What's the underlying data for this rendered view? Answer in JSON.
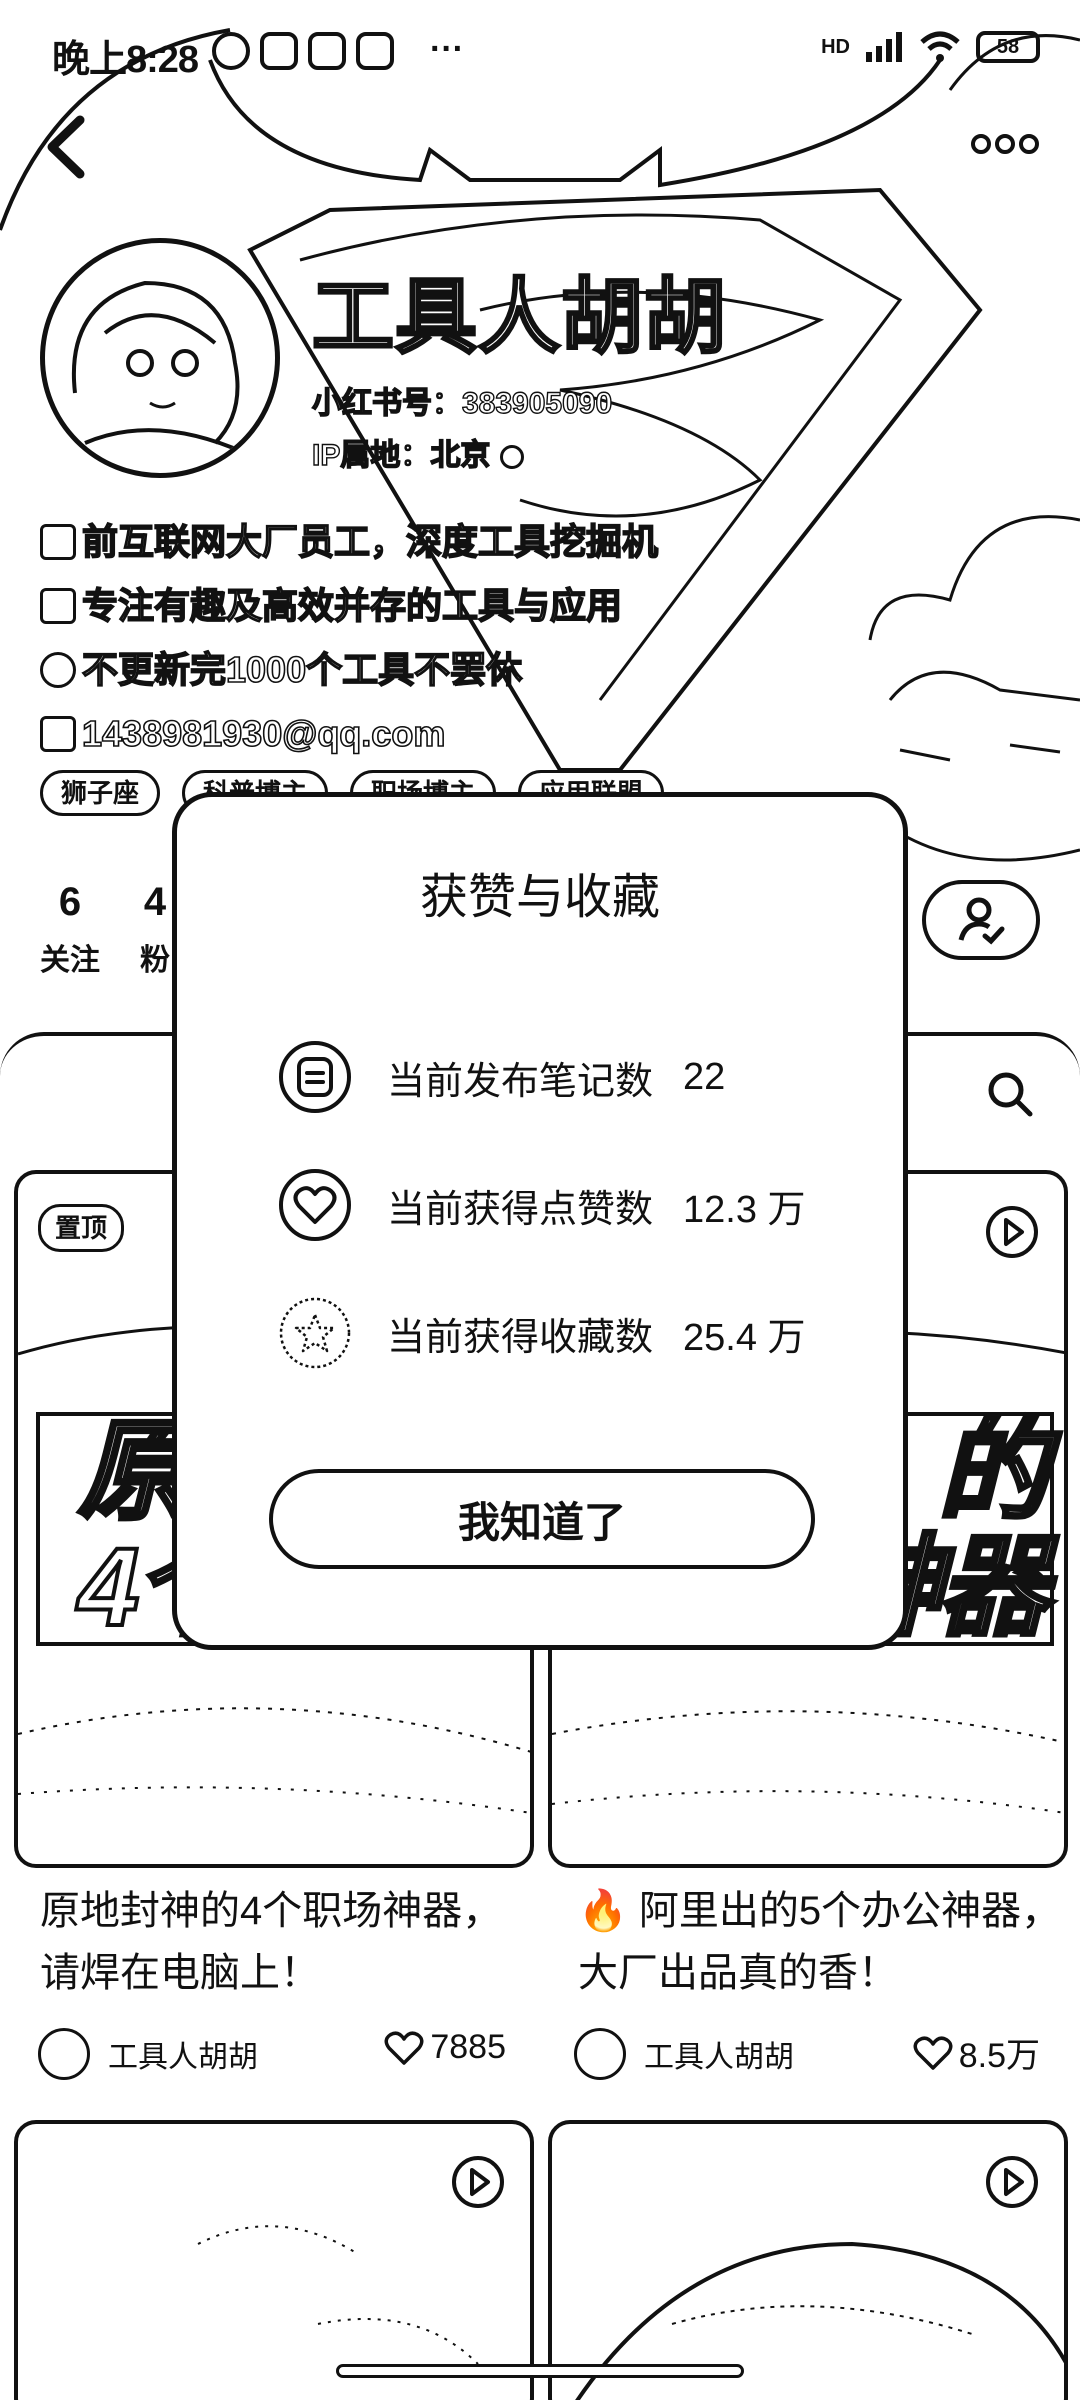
{
  "status_bar": {
    "time": "晚上8:28",
    "more": "···",
    "network": "HD",
    "battery": "58"
  },
  "profile": {
    "name": "工具人胡胡",
    "red_id": "小红书号：383905090",
    "ip_location": "IP属地：北京",
    "bio": [
      "前互联网大厂员工，深度工具挖掘机",
      "专注有趣及高效并存的工具与应用",
      "不更新完1000个工具不罢休",
      "1438981930@qq.com"
    ],
    "tags": [
      "狮子座",
      "科普博主",
      "职场博主",
      "应用联盟"
    ],
    "stats": [
      {
        "num": "6",
        "label": "关注"
      },
      {
        "num": "4",
        "label": "粉"
      }
    ]
  },
  "notes": [
    {
      "cover_text": "原\n4个",
      "pin": "置顶",
      "title": "原地封神的4个职场神器，请焊在电脑上！",
      "author": "工具人胡胡",
      "likes": "7885"
    },
    {
      "cover_text": "的\n神器",
      "title": "🔥 阿里出的5个办公神器，大厂出品真的香！",
      "author": "工具人胡胡",
      "likes": "8.5万"
    }
  ],
  "modal": {
    "title": "获赞与收藏",
    "rows": [
      {
        "label": "当前发布笔记数",
        "value": "22"
      },
      {
        "label": "当前获得点赞数",
        "value": "12.3 万"
      },
      {
        "label": "当前获得收藏数",
        "value": "25.4 万"
      }
    ],
    "button": "我知道了"
  }
}
